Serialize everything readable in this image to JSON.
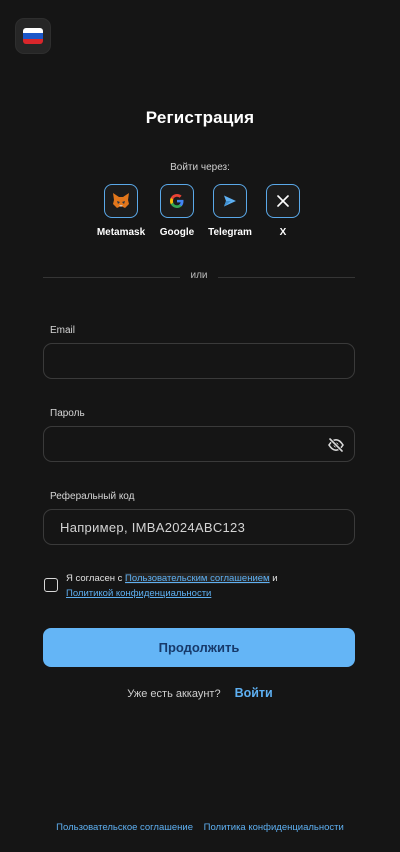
{
  "header": {
    "language_flag": "russia-flag-icon"
  },
  "title": "Регистрация",
  "social": {
    "label": "Войти через:",
    "providers": [
      {
        "name": "Metamask",
        "icon": "metamask-icon"
      },
      {
        "name": "Google",
        "icon": "google-icon"
      },
      {
        "name": "Telegram",
        "icon": "telegram-icon"
      },
      {
        "name": "X",
        "icon": "x-icon"
      }
    ]
  },
  "divider_text": "или",
  "form": {
    "email": {
      "label": "Email",
      "value": "",
      "placeholder": ""
    },
    "password": {
      "label": "Пароль",
      "value": "",
      "placeholder": "",
      "toggle_icon": "eye-off-icon"
    },
    "referral": {
      "label": "Реферальный код",
      "value": "",
      "placeholder": "Например, IMBA2024ABC123"
    }
  },
  "agreement": {
    "checked": false,
    "prefix": "Я согласен с ",
    "terms_link": "Пользовательским соглашением",
    "middle": " и",
    "privacy_link": "Политикой конфиденциальности"
  },
  "continue_label": "Продолжить",
  "login_prompt": {
    "question": "Уже есть аккаунт?",
    "login_label": "Войти"
  },
  "footer": {
    "terms": "Пользовательское соглашение",
    "privacy": "Политика конфиденциальности"
  },
  "colors": {
    "background": "#151515",
    "accent": "#64b5f6",
    "link": "#5eb0f2"
  }
}
